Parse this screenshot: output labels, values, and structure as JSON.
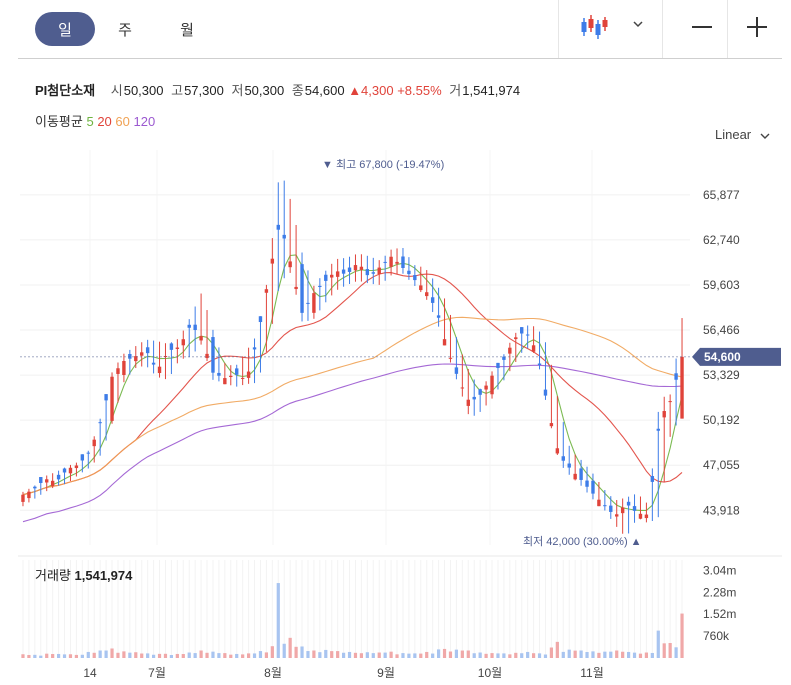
{
  "period_tabs": [
    {
      "label": "일",
      "selected": true
    },
    {
      "label": "주",
      "selected": false
    },
    {
      "label": "월",
      "selected": false
    }
  ],
  "toolbar": {
    "chart_type_icon": "candlestick-icon",
    "dropdown_icon": "chevron-down-icon",
    "zoom_out_icon": "minus-icon",
    "zoom_in_icon": "plus-icon"
  },
  "stock": {
    "name": "PI첨단소재",
    "open_label": "시",
    "open": "50,300",
    "high_label": "고",
    "high": "57,300",
    "low_label": "저",
    "low": "50,300",
    "close_label": "종",
    "close": "54,600",
    "change": "▲4,300",
    "change_pct": "+8.55%",
    "volume_label": "거",
    "volume": "1,541,974"
  },
  "moving_average": {
    "label": "이동평균",
    "periods": [
      {
        "label": "5",
        "color": "#6db33f"
      },
      {
        "label": "20",
        "color": "#e0433a"
      },
      {
        "label": "60",
        "color": "#f0a254"
      },
      {
        "label": "120",
        "color": "#9b59d0"
      }
    ]
  },
  "scale_mode": "Linear",
  "colors": {
    "up": "#e0433a",
    "down": "#3d7ce8",
    "price_tag": "#4f5d8f",
    "accent": "#4f5d8f"
  },
  "chart_data": {
    "type": "candlestick",
    "yticks": [
      "65,877",
      "62,740",
      "59,603",
      "56,466",
      "53,329",
      "50,192",
      "47,055",
      "43,918"
    ],
    "ytick_values": [
      65877,
      62740,
      59603,
      56466,
      53329,
      50192,
      47055,
      43918
    ],
    "ylim": [
      41500,
      69000
    ],
    "xticks": [
      "14",
      "7월",
      "8월",
      "9월",
      "10월",
      "11월"
    ],
    "last_price": "54,600",
    "high_annotation": "▼ 최고 67,800 (-19.47%)",
    "low_annotation": "최저 42,000 (30.00%) ▲",
    "volume_label": "거래량",
    "volume_value": "1,541,974",
    "volume_ticks": [
      "3.04m",
      "2.28m",
      "1.52m",
      "760k"
    ],
    "volume_tick_values": [
      3040000,
      2280000,
      1520000,
      760000
    ],
    "ohlc_keypoints": [
      [
        44500,
        45200,
        44200,
        45000
      ],
      [
        45000,
        45600,
        44700,
        45400
      ],
      [
        45400,
        46300,
        45200,
        46100
      ],
      [
        46100,
        46600,
        45600,
        45900
      ],
      [
        45900,
        47000,
        45800,
        46800
      ],
      [
        46800,
        47300,
        46400,
        47100
      ],
      [
        47100,
        48200,
        46900,
        48000
      ],
      [
        48000,
        50500,
        47800,
        50200
      ],
      [
        50200,
        53600,
        50000,
        53300
      ],
      [
        53300,
        54800,
        52800,
        54300
      ],
      [
        54300,
        55300,
        53800,
        54600
      ],
      [
        54600,
        55800,
        54000,
        55100
      ],
      [
        55100,
        55700,
        53200,
        53600
      ],
      [
        53600,
        55500,
        53000,
        55000
      ],
      [
        55000,
        55900,
        54400,
        55300
      ],
      [
        55300,
        57400,
        54600,
        56800
      ],
      [
        56800,
        59100,
        55500,
        56000
      ],
      [
        56000,
        56500,
        53000,
        53500
      ],
      [
        53500,
        54200,
        52800,
        53100
      ],
      [
        53100,
        53900,
        52500,
        53400
      ],
      [
        53400,
        55000,
        52700,
        53000
      ],
      [
        53000,
        56200,
        52800,
        55900
      ],
      [
        55900,
        60500,
        55500,
        60200
      ],
      [
        60200,
        67800,
        59800,
        64000
      ],
      [
        64000,
        65400,
        60500,
        61000
      ],
      [
        61000,
        61800,
        57000,
        57600
      ],
      [
        57600,
        59500,
        57200,
        59000
      ],
      [
        59000,
        60500,
        58300,
        59800
      ],
      [
        59800,
        61400,
        59200,
        60600
      ],
      [
        60600,
        61500,
        59600,
        60300
      ],
      [
        60300,
        61800,
        59900,
        61200
      ],
      [
        61200,
        61600,
        59700,
        60100
      ],
      [
        60100,
        61300,
        59600,
        60900
      ],
      [
        60900,
        62100,
        60300,
        61600
      ],
      [
        61600,
        62200,
        60400,
        60800
      ],
      [
        60800,
        61000,
        59600,
        60000
      ],
      [
        60000,
        60800,
        58800,
        59300
      ],
      [
        59300,
        59700,
        57200,
        57900
      ],
      [
        57900,
        58300,
        54800,
        55100
      ],
      [
        55100,
        55400,
        52600,
        53000
      ],
      [
        53000,
        53500,
        50300,
        51400
      ],
      [
        51400,
        52300,
        50800,
        52000
      ],
      [
        52000,
        53600,
        51700,
        53300
      ],
      [
        53300,
        54700,
        52900,
        54300
      ],
      [
        54300,
        56200,
        54100,
        55900
      ],
      [
        55900,
        56800,
        55300,
        56400
      ],
      [
        56400,
        56700,
        54700,
        55000
      ],
      [
        55000,
        55300,
        50700,
        51000
      ],
      [
        51000,
        51200,
        47200,
        47700
      ],
      [
        47700,
        48100,
        46300,
        46800
      ],
      [
        46800,
        47400,
        45600,
        46000
      ],
      [
        46000,
        46500,
        44700,
        45100
      ],
      [
        45100,
        45400,
        44000,
        44300
      ],
      [
        44300,
        44600,
        42900,
        43500
      ],
      [
        43500,
        44800,
        42000,
        44400
      ],
      [
        44400,
        45100,
        43400,
        43700
      ],
      [
        43700,
        44300,
        43000,
        43600
      ],
      [
        43600,
        51700,
        43500,
        50300
      ],
      [
        50300,
        52000,
        49400,
        51600
      ],
      [
        50300,
        57300,
        50300,
        54600
      ]
    ],
    "volume_keypoints": [
      130000,
      110000,
      150000,
      140000,
      170000,
      130000,
      210000,
      260000,
      330000,
      230000,
      200000,
      160000,
      180000,
      150000,
      140000,
      190000,
      260000,
      220000,
      170000,
      140000,
      160000,
      260000,
      420000,
      2600000,
      700000,
      400000,
      260000,
      280000,
      240000,
      210000,
      300000,
      200000,
      190000,
      220000,
      170000,
      160000,
      210000,
      320000,
      350000,
      290000,
      260000,
      190000,
      170000,
      160000,
      180000,
      210000,
      170000,
      380000,
      560000,
      290000,
      260000,
      230000,
      220000,
      260000,
      290000,
      210000,
      190000,
      950000,
      520000,
      1541974
    ]
  }
}
